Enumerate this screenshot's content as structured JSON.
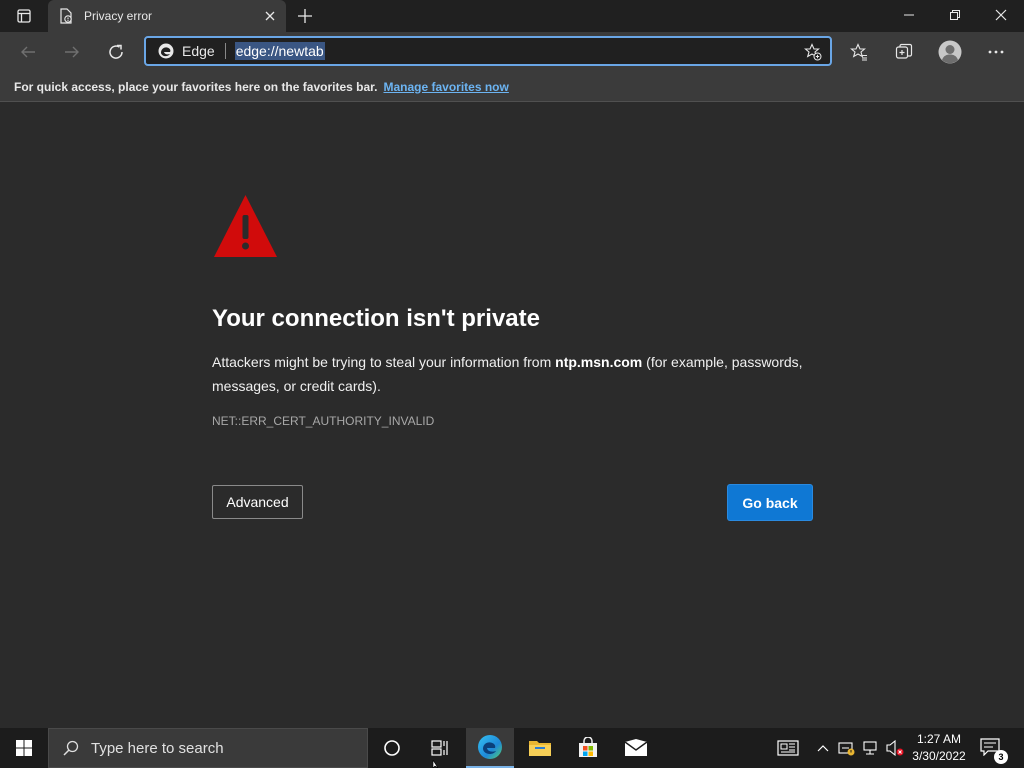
{
  "browser": {
    "tab_title": "Privacy error",
    "address_site_label": "Edge",
    "address_url": "edge://newtab",
    "favorites_bar_text": "For quick access, place your favorites here on the favorites bar.",
    "favorites_bar_link": "Manage favorites now"
  },
  "page": {
    "title": "Your connection isn't private",
    "description_before": "Attackers might be trying to steal your information from ",
    "description_host": "ntp.msn.com",
    "description_after": " (for example, passwords, messages, or credit cards).",
    "error_code": "NET::ERR_CERT_AUTHORITY_INVALID",
    "advanced_label": "Advanced",
    "go_back_label": "Go back",
    "warning_color": "#d10b0b"
  },
  "taskbar": {
    "search_placeholder": "Type here to search",
    "time": "1:27 AM",
    "date": "3/30/2022",
    "notification_count": "3"
  },
  "colors": {
    "accent": "#0f78d4",
    "link": "#6cb4f2"
  }
}
